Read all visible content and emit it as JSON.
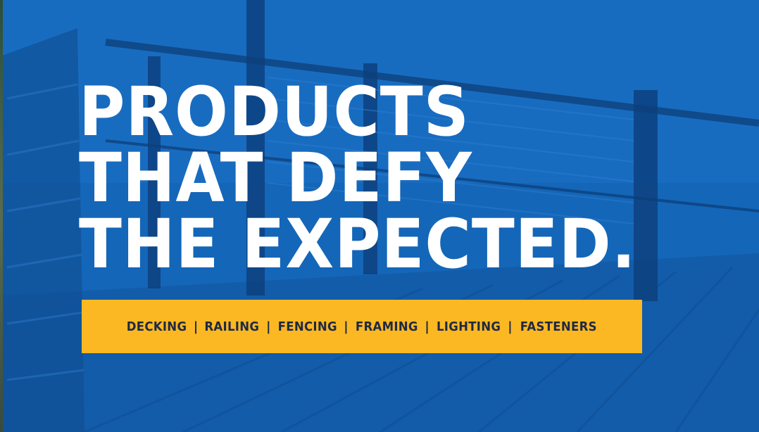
{
  "hero": {
    "headline": {
      "line1": "PRODUCTS",
      "line2": "THAT DEFY",
      "line3": "THE EXPECTED."
    },
    "colors": {
      "background": "#1463b5",
      "headline": "#ffffff",
      "nav_bar": "#fbb823",
      "nav_text": "#1f2a44"
    }
  },
  "nav": {
    "items": [
      {
        "label": "DECKING"
      },
      {
        "label": "RAILING"
      },
      {
        "label": "FENCING"
      },
      {
        "label": "FRAMING"
      },
      {
        "label": "LIGHTING"
      },
      {
        "label": "FASTENERS"
      }
    ],
    "separator": "|"
  }
}
